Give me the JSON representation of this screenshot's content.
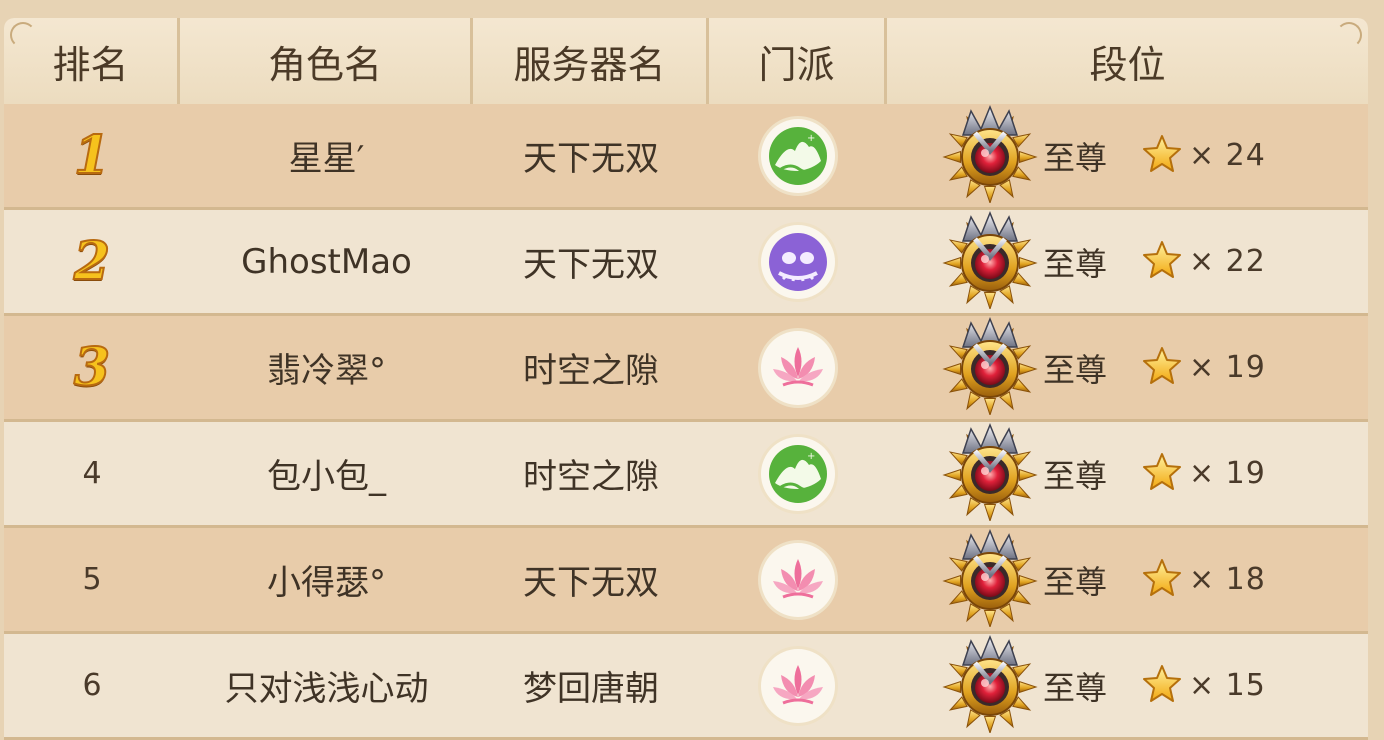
{
  "table": {
    "headers": [
      "排名",
      "角色名",
      "服务器名",
      "门派",
      "段位"
    ],
    "rows": [
      {
        "rank": "1",
        "medal": true,
        "name": "星星′",
        "server": "天下无双",
        "school_icon": "mountain-school-icon",
        "tier": "至尊",
        "stars": "× 24",
        "shade": "dark"
      },
      {
        "rank": "2",
        "medal": true,
        "name": "GhostMao",
        "server": "天下无双",
        "school_icon": "ghost-school-icon",
        "tier": "至尊",
        "stars": "× 22",
        "shade": "light"
      },
      {
        "rank": "3",
        "medal": true,
        "name": "翡冷翠°",
        "server": "时空之隙",
        "school_icon": "lotus-school-icon",
        "tier": "至尊",
        "stars": "× 19",
        "shade": "dark"
      },
      {
        "rank": "4",
        "medal": false,
        "name": "包小包_",
        "server": "时空之隙",
        "school_icon": "mountain-school-icon",
        "tier": "至尊",
        "stars": "× 19",
        "shade": "light"
      },
      {
        "rank": "5",
        "medal": false,
        "name": "小得瑟°",
        "server": "天下无双",
        "school_icon": "lotus-school-icon",
        "tier": "至尊",
        "stars": "× 18",
        "shade": "dark"
      },
      {
        "rank": "6",
        "medal": false,
        "name": "只对浅浅心动",
        "server": "梦回唐朝",
        "school_icon": "lotus-school-icon",
        "tier": "至尊",
        "stars": "× 15",
        "shade": "light"
      }
    ]
  },
  "colors": {
    "medal_gold": "#f6c21d",
    "row_dark": "#e8ccaa",
    "row_light": "#f0e4d1"
  }
}
